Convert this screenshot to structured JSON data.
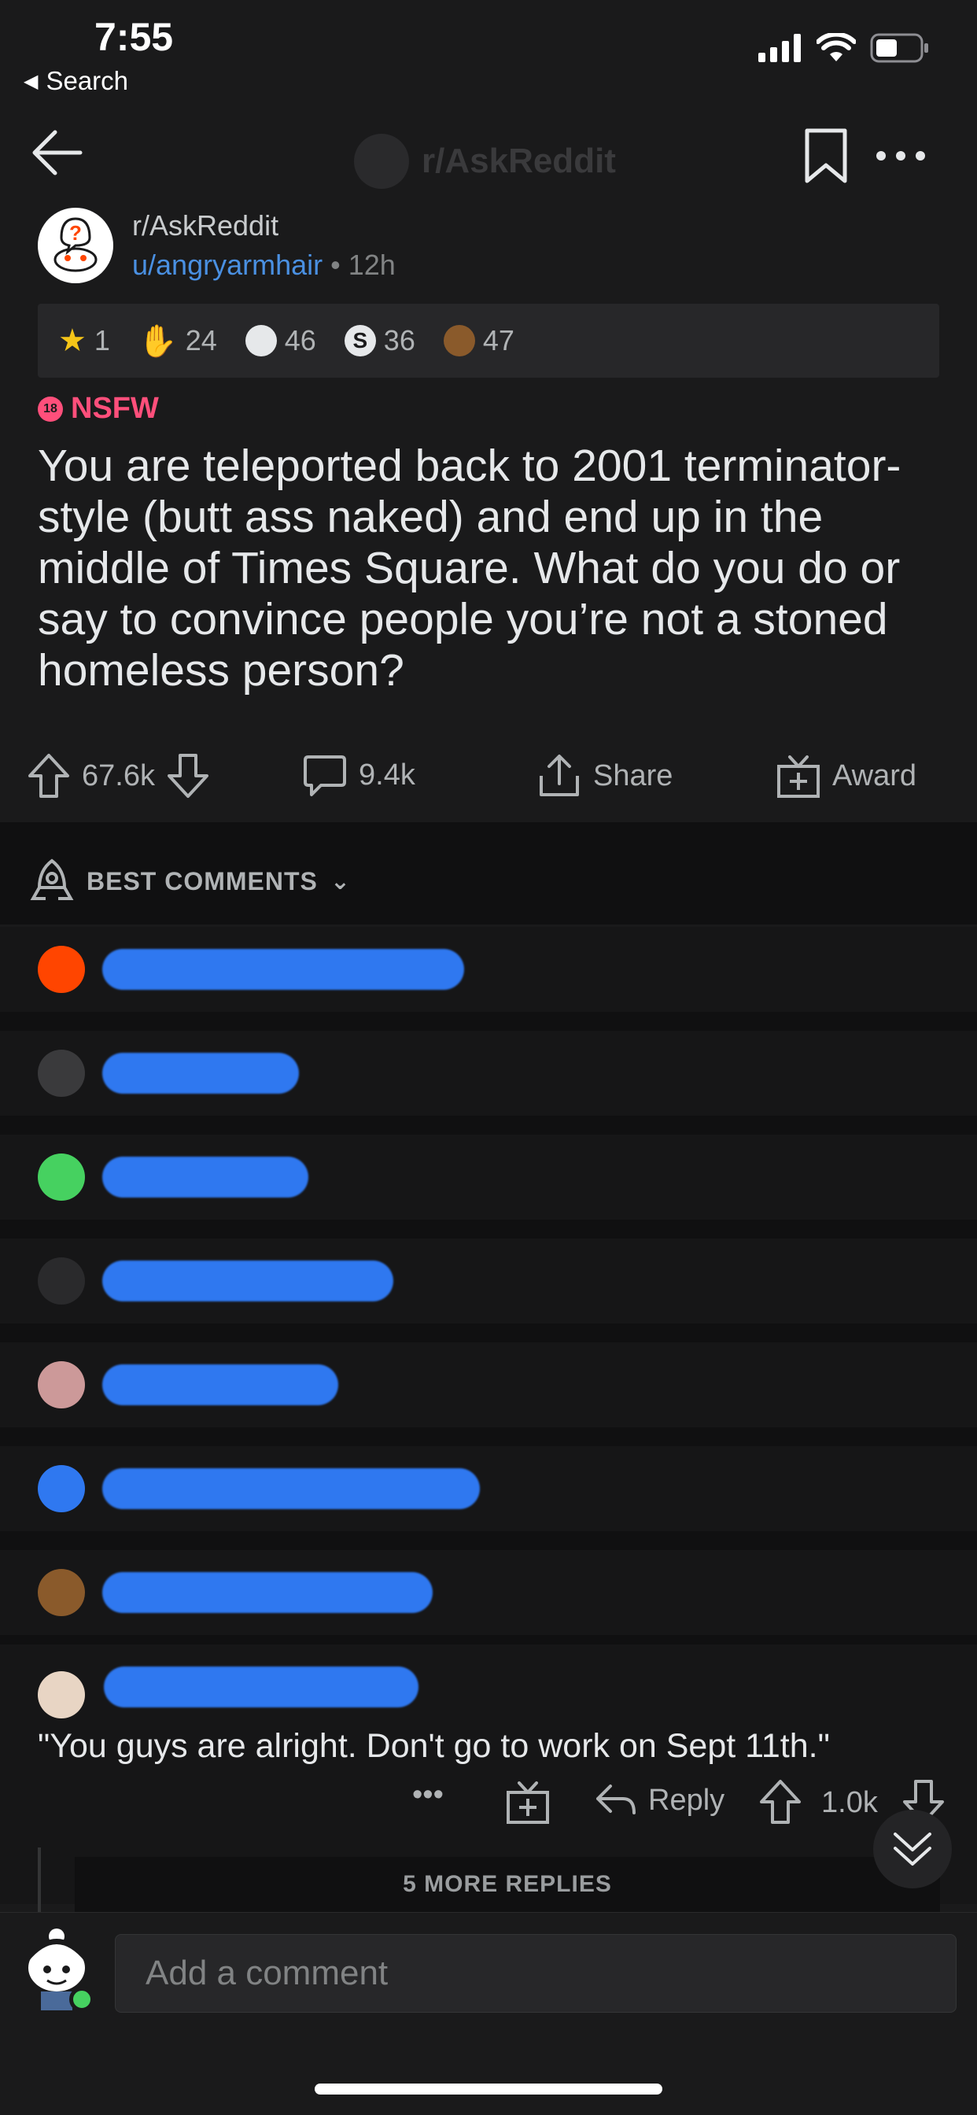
{
  "status_bar": {
    "time": "7:55",
    "back_label": "Search"
  },
  "nav": {
    "title": "r/AskReddit"
  },
  "post": {
    "subreddit": "r/AskReddit",
    "author": "u/angryarmhair",
    "separator": "•",
    "age": "12h",
    "awards": [
      {
        "icon": "gold-star-award-icon",
        "count": "1"
      },
      {
        "icon": "hand-award-icon",
        "count": "24"
      },
      {
        "icon": "wholesome-award-icon",
        "count": "46"
      },
      {
        "icon": "silver-award-icon",
        "count": "36"
      },
      {
        "icon": "monkey-award-icon",
        "count": "47"
      }
    ],
    "nsfw_badge": "18",
    "nsfw_label": "NSFW",
    "title": "You are teleported back to 2001 terminator-style (butt ass naked) and end up in the middle of Times Square. What do you do or say to convince people you’re not a stoned homeless person?",
    "votes": "67.6k",
    "comments": "9.4k",
    "share_label": "Share",
    "award_label": "Award"
  },
  "sort": {
    "label": "BEST COMMENTS"
  },
  "comment": {
    "text": "\"You guys are alright. Don't go to work on Sept 11th.\"",
    "reply_label": "Reply",
    "votes": "1.0k",
    "more_replies": "5 MORE REPLIES"
  },
  "composer": {
    "placeholder": "Add a comment"
  },
  "colors": {
    "accent": "#4a90e2",
    "nsfw": "#ff4f7b",
    "redaction": "#2f78f0",
    "online": "#46d160"
  }
}
